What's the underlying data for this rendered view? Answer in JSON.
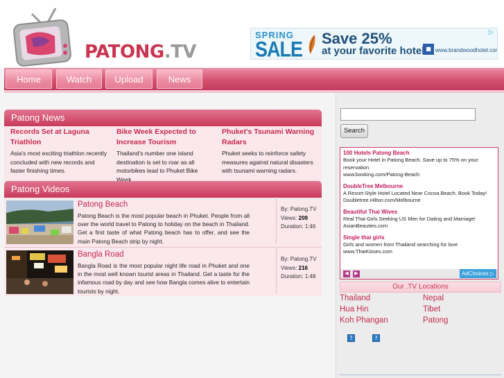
{
  "header": {
    "logo_text_main": "PATONG",
    "logo_text_suffix": ".TV"
  },
  "banner_ad": {
    "spring": "SPRING",
    "sale": "SALE",
    "headline": "Save 25%",
    "subline": "at your favorite hotel.",
    "url": "www.brandwoodhotel.com",
    "close_icon": "close-icon"
  },
  "nav": {
    "items": [
      {
        "label": "Home"
      },
      {
        "label": "Watch"
      },
      {
        "label": "Upload"
      },
      {
        "label": "News"
      }
    ]
  },
  "news": {
    "heading": "Patong News",
    "items": [
      {
        "title": "Records Set at Laguna Triathlon",
        "text": "Asia's most exciting triathlon recently concluded with new records and faster finishing times."
      },
      {
        "title": "Bike Week Expected to Increase Tourism",
        "text": "Thailand's number one island destination is set to roar as all motorbikes lead to Phuket Bike Week."
      },
      {
        "title": "Phuket's Tsunami Warning Radars",
        "text": "Phuket seeks to reinforce safety measures against natural disasters with tsunami warning radars."
      }
    ]
  },
  "videos": {
    "heading": "Patong Videos",
    "items": [
      {
        "title": "Patong Beach",
        "description": "Patong Beach is the most popular beach in Phuket. People from all over the world travel to Patong to holiday on the beach in Thailand. Get a first taste of what Patong beach has to offer, and see the main Patong Beach strip by night.",
        "by_label": "By:",
        "by": "Patong.TV",
        "views_label": "Views:",
        "views": "209",
        "duration_label": "Duration:",
        "duration": "1:46"
      },
      {
        "title": "Bangla Road",
        "description": "Bangla Road is the most popular night life road in Phuket and one in the most well known tourist areas in Thailand. Get a taste for the infamous road by day and see how Bangla comes alive to entertain tourists by night.",
        "by_label": "By:",
        "by": "Patong.TV",
        "views_label": "Views:",
        "views": "216",
        "duration_label": "Duration:",
        "duration": "1:48"
      }
    ]
  },
  "search": {
    "value": "",
    "button_label": "Search"
  },
  "ads": {
    "items": [
      {
        "title": "100 Hotels Patong Beach",
        "text": "Book your Hotel in Patong Beach. Save up to 75% on your reservation.",
        "url": "www.booking.com/Patong-Beach"
      },
      {
        "title": "DoubleTree Melbourne",
        "text": "A Resort-Style Hotel Located Near Cocoa Beach. Book Today!",
        "url": "Doubletree.Hilton.com/Melbourne"
      },
      {
        "title": "Beautiful Thai Wives",
        "text": "Real Thai Girls Seeking US Men for Dating and Marriage!",
        "url": "AsianBeauties.com"
      },
      {
        "title": "Single thai girls",
        "text": "Girls and women from Thailand searching for love",
        "url": "www.ThaiKisses.com"
      }
    ],
    "prev_icon": "chevron-left-icon",
    "next_icon": "chevron-right-icon",
    "adchoices": "AdChoices"
  },
  "locations": {
    "heading": "Our .TV Locations",
    "left": [
      "Thailand",
      "Hua Hin",
      "Koh Phangan"
    ],
    "right": [
      "Nepal",
      "Tibet",
      "Patong"
    ]
  },
  "colors": {
    "brand": "#c62a4e",
    "nav": "#d4506f",
    "panel_bg": "#fbe8ed"
  }
}
